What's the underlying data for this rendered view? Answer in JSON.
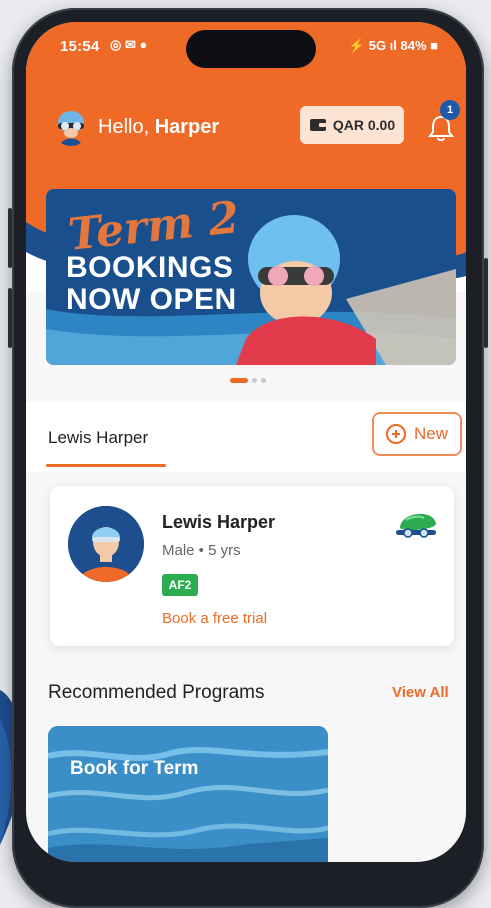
{
  "status_bar": {
    "time": "15:54",
    "left_icons": "◎ ✉ ●",
    "right_icons": "⚡ 5G ıl 84% ■"
  },
  "header": {
    "greeting_prefix": "Hello, ",
    "user_name": "Harper",
    "wallet_balance": "QAR 0.00",
    "notification_count": "1"
  },
  "banner": {
    "script_text": "Term 2",
    "line1": "BOOKINGS",
    "line2": "NOW OPEN",
    "active_index": 0,
    "total": 3
  },
  "profile_tabs": {
    "active_name": "Lewis Harper",
    "new_button_label": "New"
  },
  "swimmer_card": {
    "name": "Lewis Harper",
    "meta": "Male • 5 yrs",
    "level_badge": "AF2",
    "trial_link": "Book a free trial"
  },
  "recommended": {
    "title": "Recommended Programs",
    "view_all_label": "View All",
    "programs": [
      {
        "label": "Book for Term"
      }
    ]
  },
  "colors": {
    "brand_orange": "#ee6a26",
    "brand_blue": "#1d4f8f",
    "level_green": "#2cab50"
  }
}
